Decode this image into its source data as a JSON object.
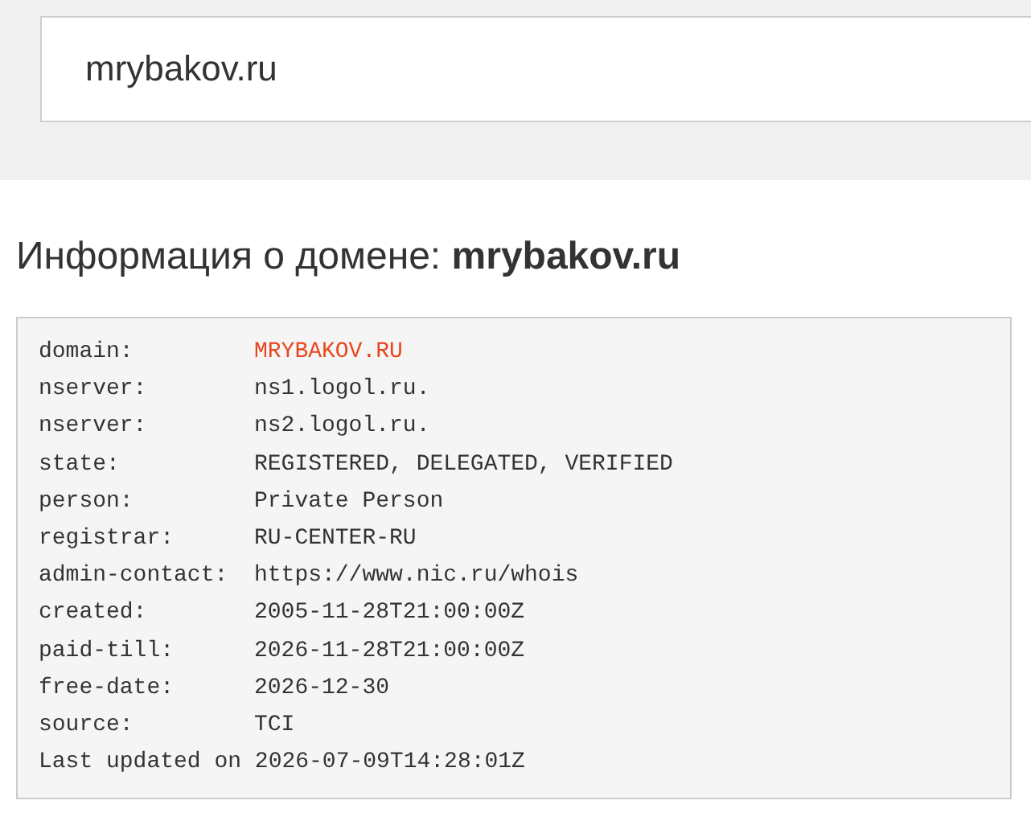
{
  "search": {
    "value": "mrybakov.ru"
  },
  "heading": "Информация о домене: **mrybakov.ru**",
  "whois": {
    "rows": [
      {
        "key": "domain:",
        "value": "MRYBAKOV.RU",
        "highlighted": true
      },
      {
        "key": "nserver:",
        "value": "ns1.logol.ru.",
        "highlighted": false
      },
      {
        "key": "nserver:",
        "value": "ns2.logol.ru.",
        "highlighted": false
      },
      {
        "key": "state:",
        "value": "REGISTERED, DELEGATED, VERIFIED",
        "highlighted": false
      },
      {
        "key": "person:",
        "value": "Private Person",
        "highlighted": false
      },
      {
        "key": "registrar:",
        "value": "RU-CENTER-RU",
        "highlighted": false
      },
      {
        "key": "admin-contact:",
        "value": "https://www.nic.ru/whois",
        "highlighted": false
      },
      {
        "key": "created:",
        "value": "2005-11-28T21:00:00Z",
        "highlighted": false
      },
      {
        "key": "paid-till:",
        "value": "2026-11-28T21:00:00Z",
        "highlighted": false
      },
      {
        "key": "free-date:",
        "value": "2026-12-30",
        "highlighted": false
      },
      {
        "key": "source:",
        "value": "TCI",
        "highlighted": false
      }
    ],
    "footer": "Last updated on 2026-07-09T14:28:01Z"
  }
}
